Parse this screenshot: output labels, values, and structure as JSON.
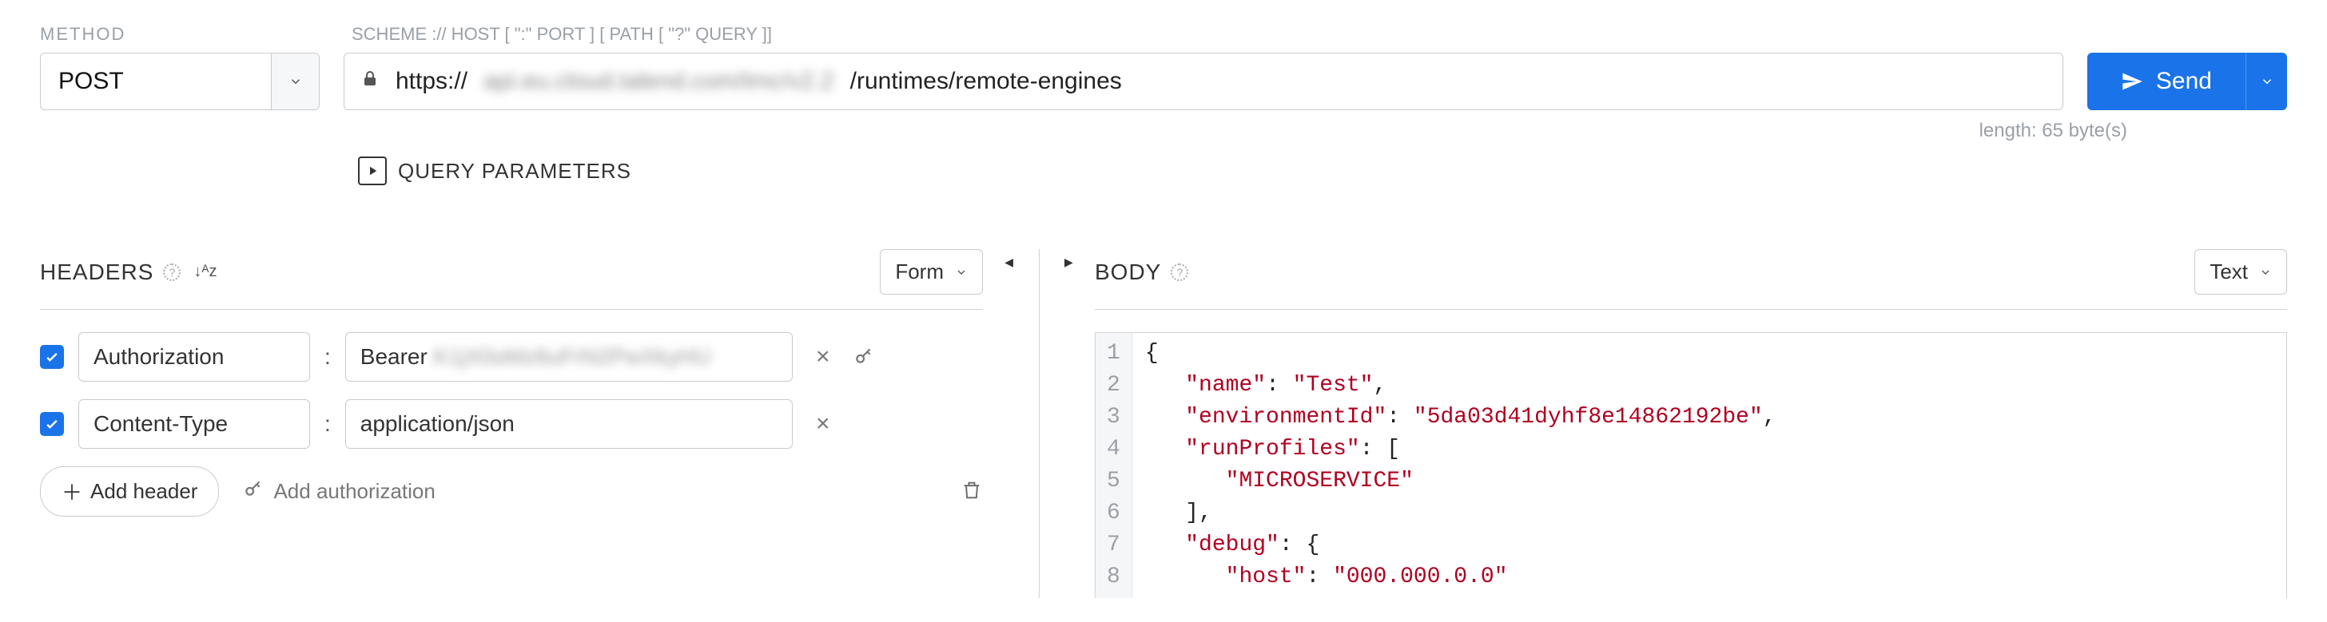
{
  "labels": {
    "method": "METHOD",
    "url_hint": "SCHEME :// HOST [ \":\" PORT ] [ PATH [ \"?\" QUERY ]]",
    "query_params": "QUERY PARAMETERS",
    "length": "length: 65 byte(s)"
  },
  "method": {
    "value": "POST"
  },
  "url": {
    "scheme": "https://",
    "blurred": "api.eu.cloud.talend.com/tmc/v2.2",
    "path": "/runtimes/remote-engines"
  },
  "send": {
    "label": "Send"
  },
  "headers_panel": {
    "title": "HEADERS",
    "mode": "Form",
    "rows": [
      {
        "enabled": true,
        "key": "Authorization",
        "value_prefix": "Bearer ",
        "value_blurred": "K1jX0oMz6uFrN2PwXkyHU",
        "show_key_icon": true
      },
      {
        "enabled": true,
        "key": "Content-Type",
        "value": "application/json",
        "show_key_icon": false
      }
    ],
    "add_header": "Add header",
    "add_auth": "Add authorization"
  },
  "body_panel": {
    "title": "BODY",
    "mode": "Text",
    "code_lines": [
      {
        "n": 1,
        "segs": [
          {
            "t": "{",
            "c": "brace"
          }
        ]
      },
      {
        "n": 2,
        "segs": [
          {
            "t": "   ",
            "c": "p"
          },
          {
            "t": "\"name\"",
            "c": "key"
          },
          {
            "t": ": ",
            "c": "p"
          },
          {
            "t": "\"Test\"",
            "c": "str"
          },
          {
            "t": ",",
            "c": "p"
          }
        ]
      },
      {
        "n": 3,
        "segs": [
          {
            "t": "   ",
            "c": "p"
          },
          {
            "t": "\"environmentId\"",
            "c": "key"
          },
          {
            "t": ": ",
            "c": "p"
          },
          {
            "t": "\"5da03d41dyhf8e14862192be\"",
            "c": "str"
          },
          {
            "t": ",",
            "c": "p"
          }
        ]
      },
      {
        "n": 4,
        "segs": [
          {
            "t": "   ",
            "c": "p"
          },
          {
            "t": "\"runProfiles\"",
            "c": "key"
          },
          {
            "t": ": [",
            "c": "p"
          }
        ]
      },
      {
        "n": 5,
        "segs": [
          {
            "t": "      ",
            "c": "p"
          },
          {
            "t": "\"MICROSERVICE\"",
            "c": "str"
          }
        ]
      },
      {
        "n": 6,
        "segs": [
          {
            "t": "   ],",
            "c": "p"
          }
        ]
      },
      {
        "n": 7,
        "segs": [
          {
            "t": "   ",
            "c": "p"
          },
          {
            "t": "\"debug\"",
            "c": "key"
          },
          {
            "t": ": {",
            "c": "p"
          }
        ]
      },
      {
        "n": 8,
        "segs": [
          {
            "t": "      ",
            "c": "p"
          },
          {
            "t": "\"host\"",
            "c": "key"
          },
          {
            "t": ": ",
            "c": "p"
          },
          {
            "t": "\"000.000.0.0\"",
            "c": "str"
          }
        ]
      }
    ]
  }
}
